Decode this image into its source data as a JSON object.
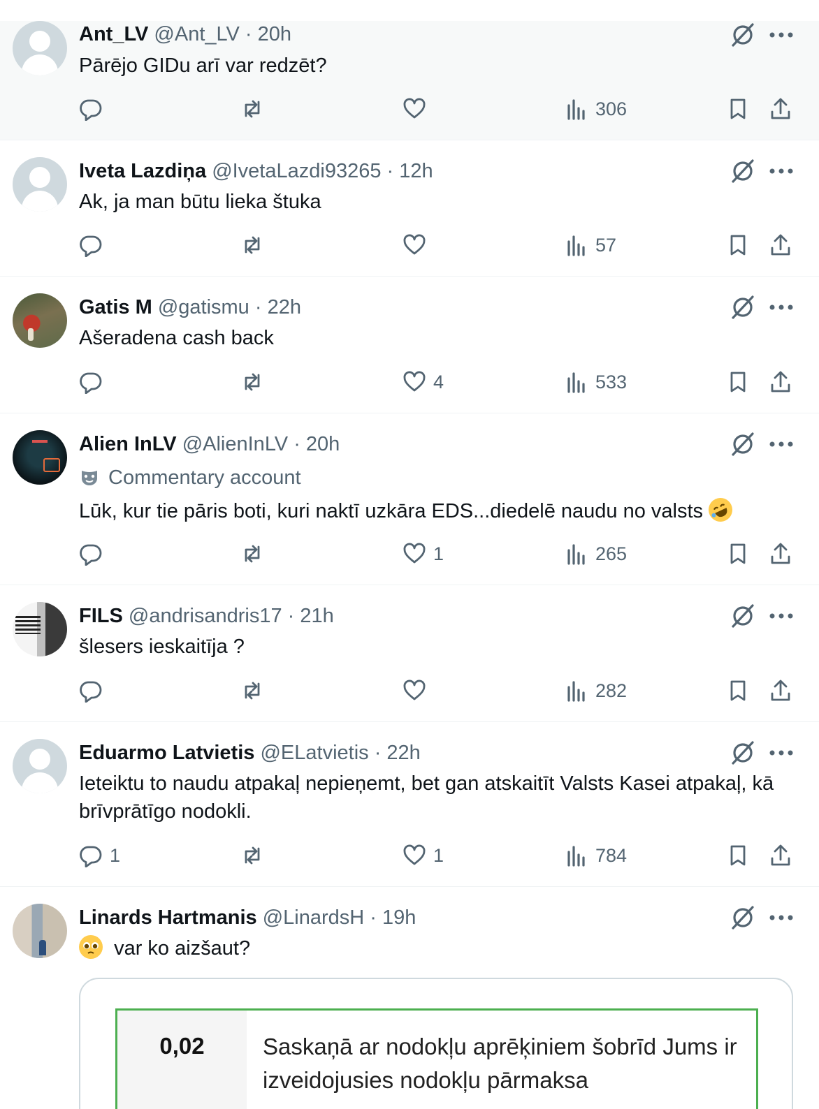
{
  "tweets": [
    {
      "name": "Ant_LV",
      "handle": "@Ant_LV · 20h",
      "text": "Pārējo GIDu arī var redzēt?",
      "replies": "",
      "likes": "",
      "views": "306",
      "avatar": "default-avatar"
    },
    {
      "name": "Iveta Lazdiņa",
      "handle": "@IvetaLazdi93265 · 12h",
      "text": "Ak, ja man būtu lieka štuka",
      "replies": "",
      "likes": "",
      "views": "57",
      "avatar": "default-avatar"
    },
    {
      "name": "Gatis M",
      "handle": "@gatismu · 22h",
      "text": "Ašeradena cash back",
      "replies": "",
      "likes": "4",
      "views": "533",
      "avatar": "mushroom-photo"
    },
    {
      "name": "Alien InLV",
      "handle": "@AlienInLV · 20h",
      "label": "Commentary account",
      "label_icon": "theater-mask-icon",
      "text": "Lūk, kur tie pāris  boti, kuri naktī uzkāra  EDS...diedelē naudu no valsts",
      "text_emoji": "rofl-emoji",
      "replies": "",
      "likes": "1",
      "views": "265",
      "avatar": "dark-profile-photo"
    },
    {
      "name": "FILS",
      "handle": "@andrisandris17 · 21h",
      "text": "šlesers ieskaitīja ?",
      "replies": "",
      "likes": "",
      "views": "282",
      "avatar": "quote-profile-photo"
    },
    {
      "name": "Eduarmo Latvietis",
      "handle": "@ELatvietis · 22h",
      "text": "Ieteiktu to naudu atpakaļ nepieņemt, bet gan atskaitīt Valsts Kasei atpakaļ, kā brīvprātīgo nodokli.",
      "replies": "1",
      "likes": "1",
      "views": "784",
      "avatar": "default-avatar"
    },
    {
      "name": "Linards Hartmanis",
      "handle": "@LinardsH · 19h",
      "text": "var ko aizšaut?",
      "text_emoji": "pleading-face-emoji",
      "avatar": "street-photo"
    }
  ],
  "media_card": {
    "amount": "0,02",
    "message": "Saskaņā ar nodokļu aprēķiniem šobrīd Jums ir izveidojusies nodokļu pārmaksa"
  },
  "icons": {
    "grok": "grok-icon",
    "more": "more-options-icon",
    "reply": "reply-icon",
    "retweet": "retweet-icon",
    "like": "like-icon",
    "views": "views-icon",
    "bookmark": "bookmark-icon",
    "share": "share-icon"
  },
  "colors": {
    "text": "#0f1419",
    "secondary": "#536471",
    "divider": "#eff3f4",
    "highlight_background": "#f7f9f9",
    "card_border_green": "#4caf50"
  }
}
